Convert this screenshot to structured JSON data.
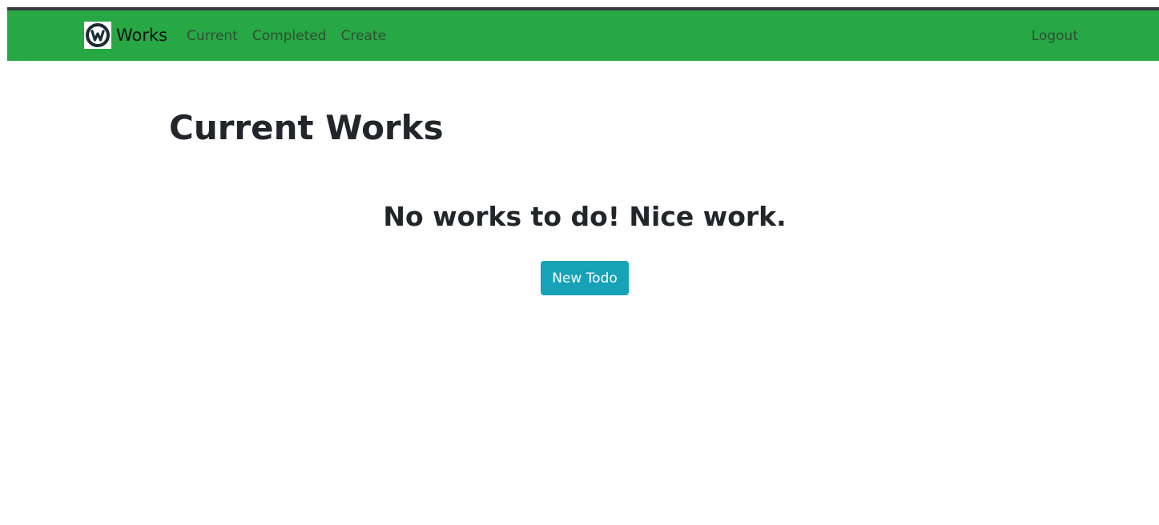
{
  "navbar": {
    "brand": "Works",
    "links": [
      "Current",
      "Completed",
      "Create"
    ],
    "logout": "Logout",
    "bg_color": "#28a745",
    "logo_icon": "workplace-logo-icon"
  },
  "main": {
    "title": "Current Works",
    "empty_message": "No works to do! Nice work.",
    "new_todo_label": "New Todo",
    "button_color": "#17a2b8"
  }
}
